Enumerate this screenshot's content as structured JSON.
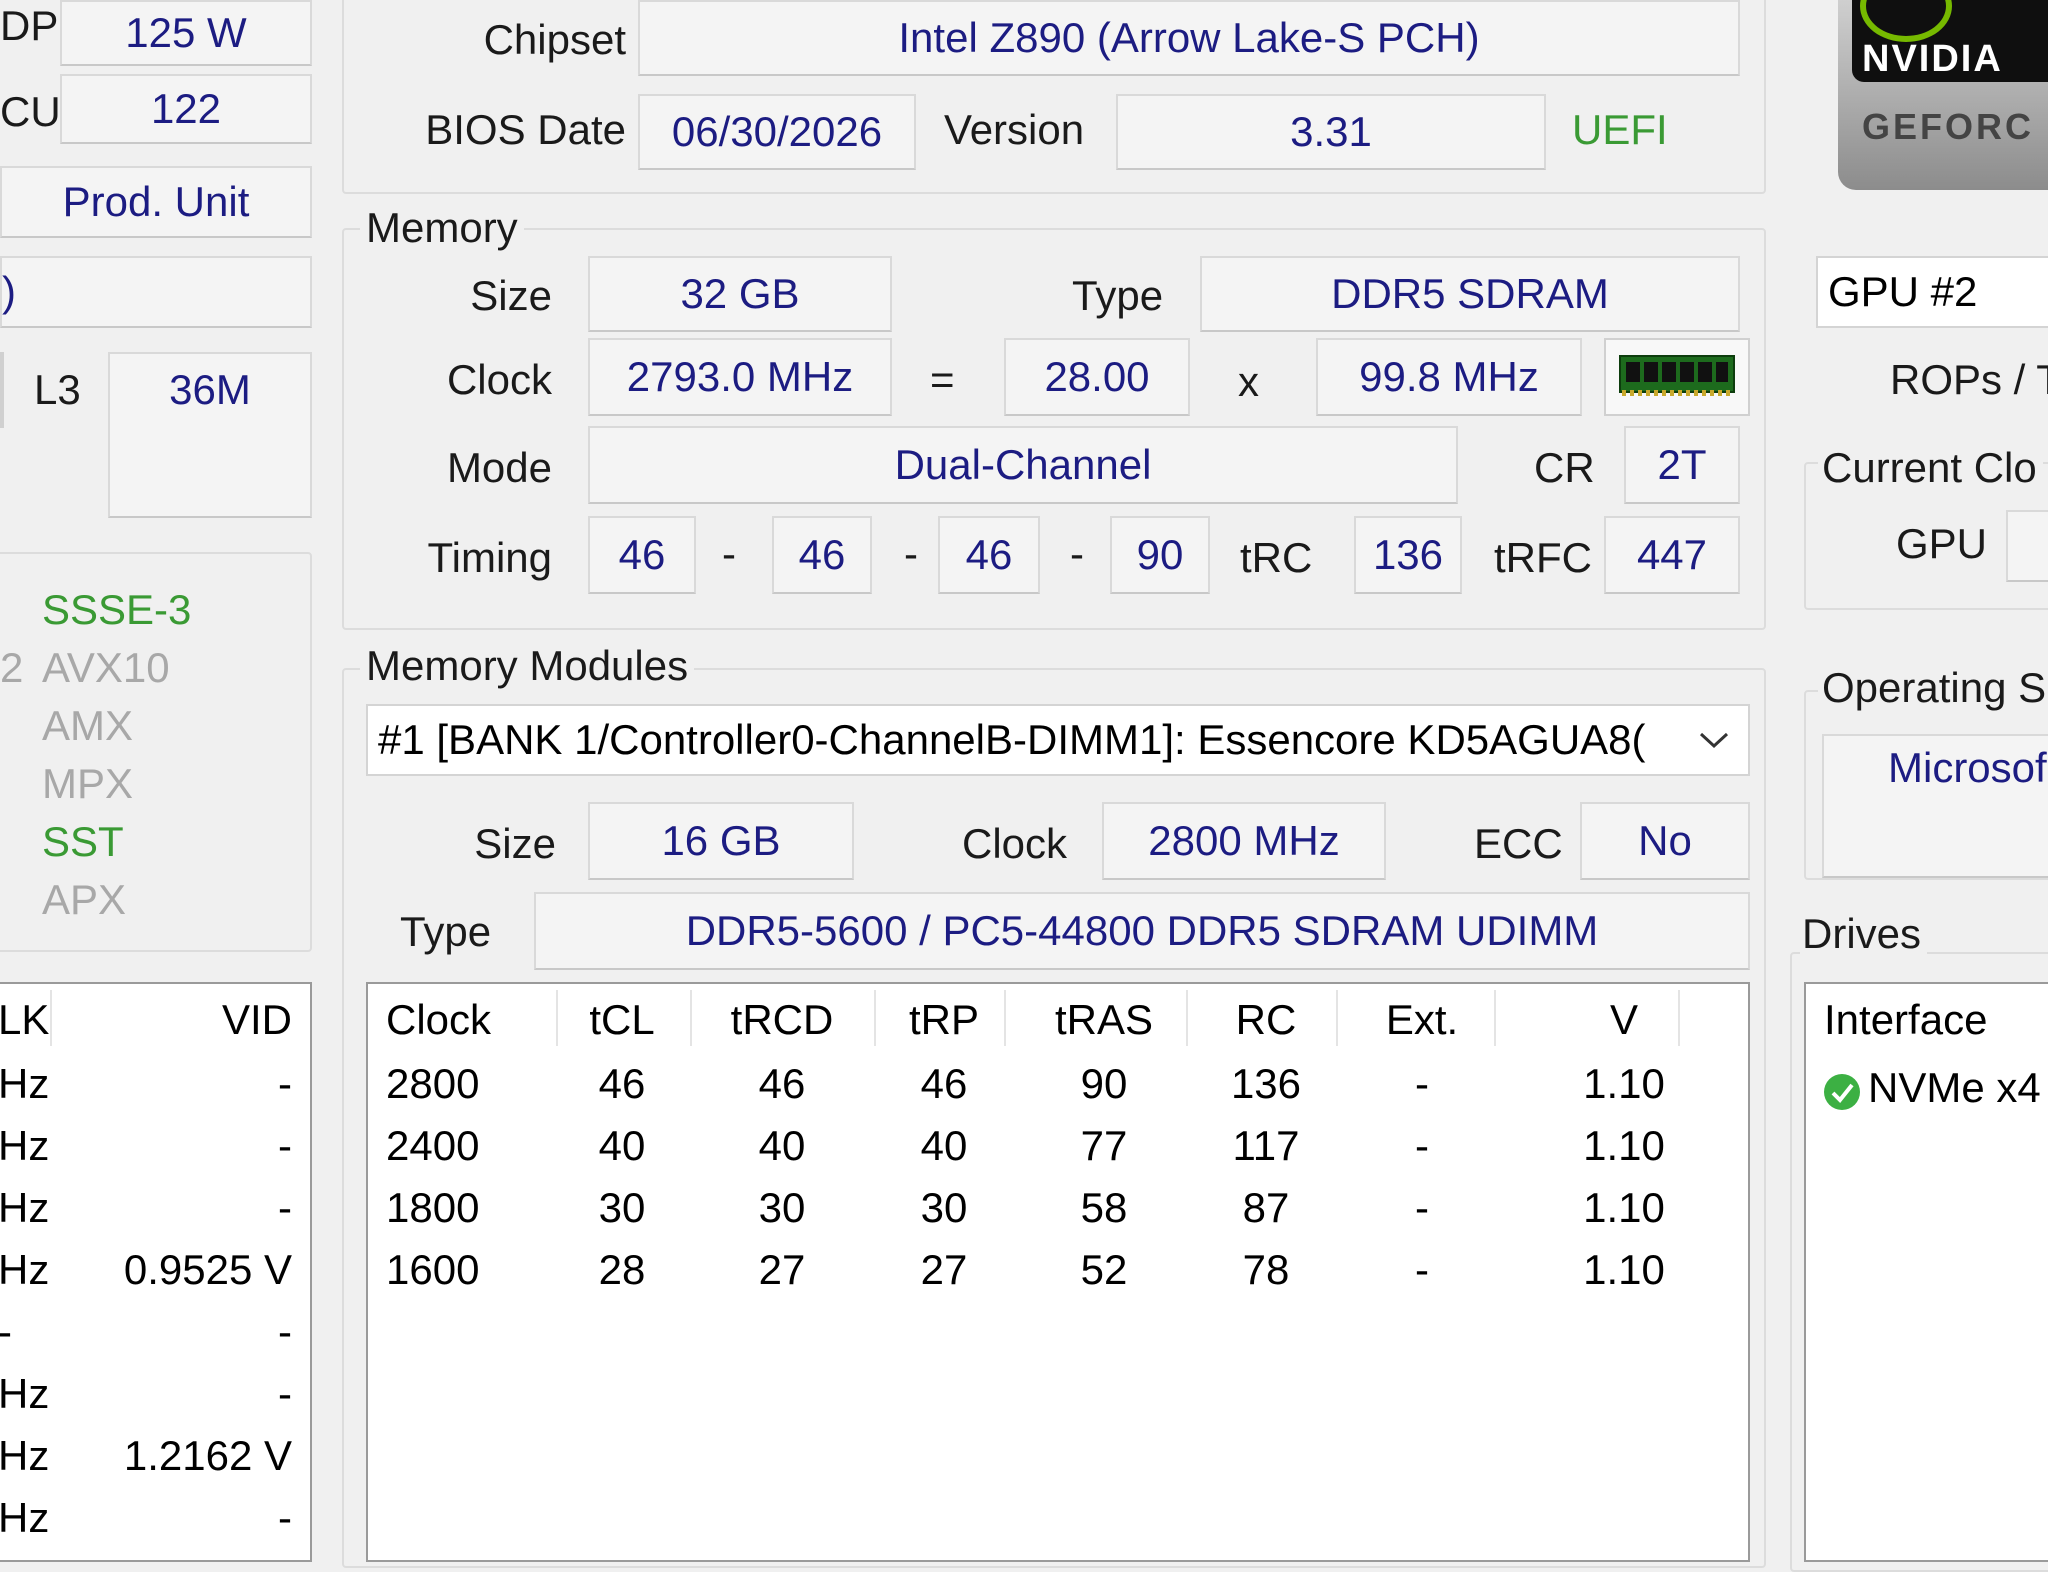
{
  "left": {
    "tdp_label_partial": "DP",
    "tdp_value": "125 W",
    "cu_label_partial": "CU",
    "cu_value": "122",
    "prod_unit": "Prod. Unit",
    "paren_partial": ")",
    "l3_label": "L3",
    "l3_value": "36M",
    "instructions": [
      {
        "text": "SSSE-3",
        "enabled": true
      },
      {
        "text": "AVX10",
        "enabled": false
      },
      {
        "text": "AMX",
        "enabled": false
      },
      {
        "text": "MPX",
        "enabled": false
      },
      {
        "text": "SST",
        "enabled": true
      },
      {
        "text": "APX",
        "enabled": false
      }
    ],
    "avx_prefix_partial": "2",
    "clock_table": {
      "col1": "LK",
      "col2": "VID",
      "rows": [
        {
          "a": "Hz",
          "b": "-"
        },
        {
          "a": "Hz",
          "b": "-"
        },
        {
          "a": "Hz",
          "b": "-"
        },
        {
          "a": "Hz",
          "b": "0.9525 V"
        },
        {
          "a": "-",
          "b": "-"
        },
        {
          "a": "Hz",
          "b": "-"
        },
        {
          "a": "Hz",
          "b": "1.2162 V"
        },
        {
          "a": "Hz",
          "b": "-"
        }
      ]
    }
  },
  "motherboard": {
    "chipset_label": "Chipset",
    "chipset_value": "Intel Z890 (Arrow Lake-S PCH)",
    "bios_date_label": "BIOS Date",
    "bios_date_value": "06/30/2026",
    "version_label": "Version",
    "version_value": "3.31",
    "uefi": "UEFI"
  },
  "memory": {
    "title": "Memory",
    "size_label": "Size",
    "size_value": "32 GB",
    "type_label": "Type",
    "type_value": "DDR5 SDRAM",
    "clock_label": "Clock",
    "clock_value": "2793.0 MHz",
    "equals": "=",
    "multiplier": "28.00",
    "times": "x",
    "bus": "99.8 MHz",
    "mode_label": "Mode",
    "mode_value": "Dual-Channel",
    "cr_label": "CR",
    "cr_value": "2T",
    "timing_label": "Timing",
    "t1": "46",
    "t2": "46",
    "t3": "46",
    "t4": "90",
    "dash": "-",
    "trc_label": "tRC",
    "trc_value": "136",
    "trfc_label": "tRFC",
    "trfc_value": "447"
  },
  "modules": {
    "title": "Memory Modules",
    "selected": "#1 [BANK 1/Controller0-ChannelB-DIMM1]: Essencore KD5AGUA8(",
    "size_label": "Size",
    "size_value": "16 GB",
    "clock_label": "Clock",
    "clock_value": "2800 MHz",
    "ecc_label": "ECC",
    "ecc_value": "No",
    "type_label": "Type",
    "type_value": "DDR5-5600 / PC5-44800 DDR5 SDRAM UDIMM",
    "columns": [
      "Clock",
      "tCL",
      "tRCD",
      "tRP",
      "tRAS",
      "RC",
      "Ext.",
      "V"
    ],
    "rows": [
      [
        "2800",
        "46",
        "46",
        "46",
        "90",
        "136",
        "-",
        "1.10"
      ],
      [
        "2400",
        "40",
        "40",
        "40",
        "77",
        "117",
        "-",
        "1.10"
      ],
      [
        "1800",
        "30",
        "30",
        "30",
        "58",
        "87",
        "-",
        "1.10"
      ],
      [
        "1600",
        "28",
        "27",
        "27",
        "52",
        "78",
        "-",
        "1.10"
      ]
    ]
  },
  "right": {
    "logo_line1": "NVIDIA",
    "logo_line2": "GEFORC",
    "gpu_select": "GPU #2",
    "rops_partial": "ROPs / T",
    "current_clock_partial": "Current Clo",
    "gpu_label": "GPU",
    "os_title_partial": "Operating S",
    "os_value_partial": "Microsof",
    "drives_title": "Drives",
    "drives_col": "Interface",
    "drive_row": "NVMe x4"
  },
  "colors": {
    "value_text": "#1c1c82",
    "green_text": "#3a9a34",
    "disabled_text": "#a8a8a8",
    "background": "#f0f0f0",
    "ok_icon": "#3cb043"
  },
  "icons": [
    "memory-stick-icon",
    "chevron-down-icon",
    "check-circle-icon",
    "nvidia-logo"
  ]
}
